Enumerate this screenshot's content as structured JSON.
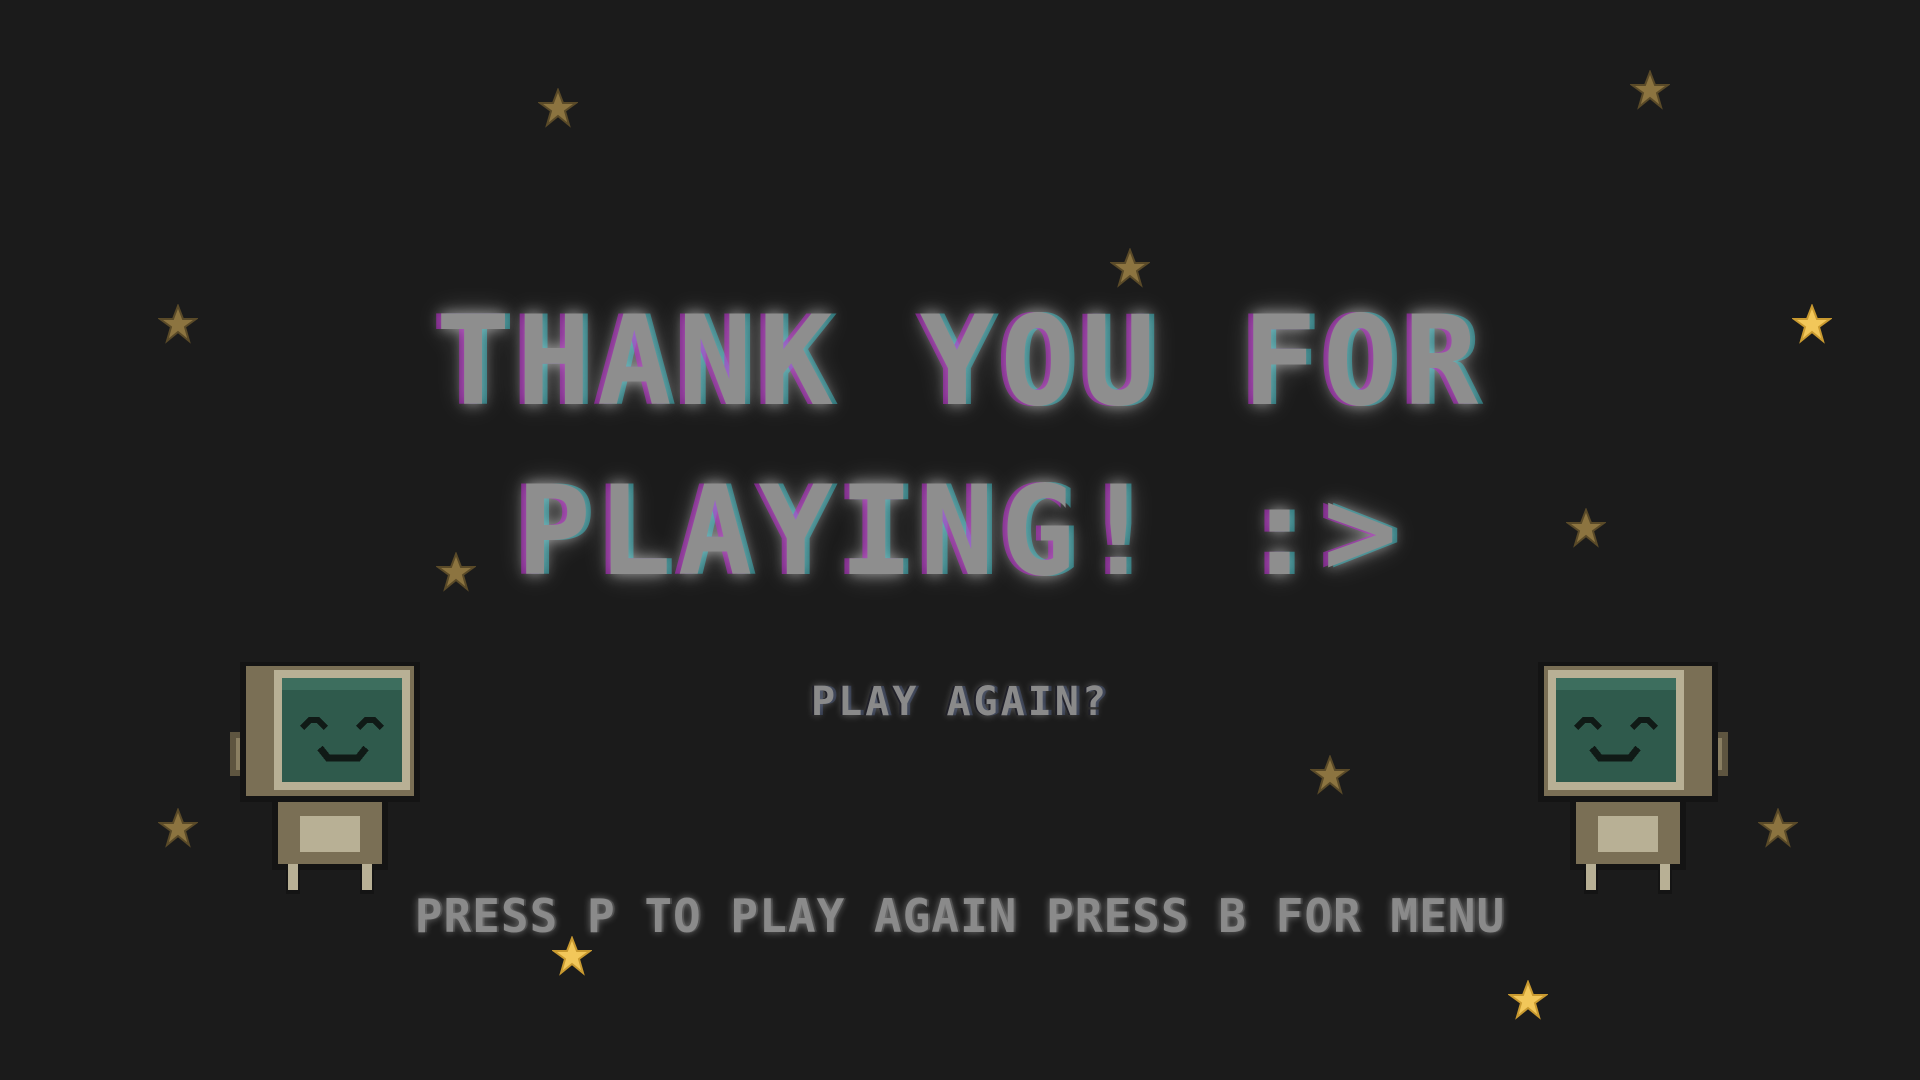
{
  "screen": {
    "title_line_1": "THANK YOU FOR",
    "title_line_2": "PLAYING! :>",
    "play_again_label": "PLAY AGAIN?",
    "instructions": "PRESS P TO PLAY AGAIN PRESS B FOR MENU"
  },
  "colors": {
    "background": "#1b1b1b",
    "text": "#8e8e8e",
    "star_dim": "#8c7440",
    "star_bright": "#f2c75a",
    "robot_body": "#7a6f55",
    "robot_screen": "#2f5a4c"
  },
  "icons": {
    "star": "star-icon",
    "robot": "tv-head-robot-icon"
  }
}
